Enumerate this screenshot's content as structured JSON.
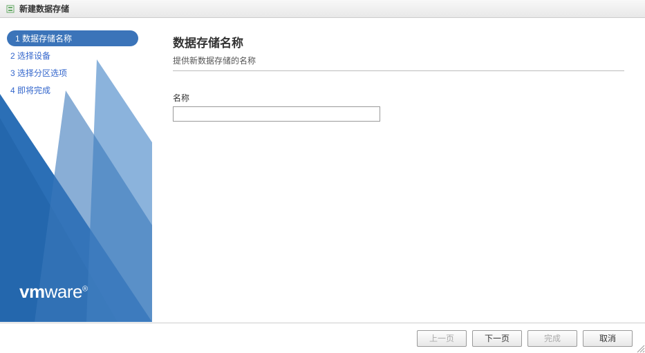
{
  "window": {
    "title": "新建数据存储"
  },
  "sidebar": {
    "steps": [
      {
        "num": "1",
        "label": "数据存储名称",
        "active": true
      },
      {
        "num": "2",
        "label": "选择设备",
        "active": false
      },
      {
        "num": "3",
        "label": "选择分区选项",
        "active": false
      },
      {
        "num": "4",
        "label": "即将完成",
        "active": false
      }
    ],
    "logo_text": "vmware"
  },
  "main": {
    "title": "数据存储名称",
    "subtitle": "提供新数据存储的名称",
    "name_label": "名称",
    "name_value": ""
  },
  "buttons": {
    "back": "上一页",
    "next": "下一页",
    "finish": "完成",
    "cancel": "取消"
  }
}
